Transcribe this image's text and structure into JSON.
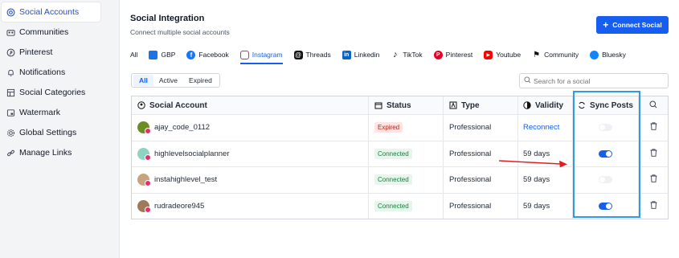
{
  "sidebar": {
    "items": [
      {
        "label": "Social Accounts",
        "icon": "at-icon"
      },
      {
        "label": "Communities",
        "icon": "people-icon"
      },
      {
        "label": "Pinterest",
        "icon": "pinterest-icon"
      },
      {
        "label": "Notifications",
        "icon": "bell-icon"
      },
      {
        "label": "Social Categories",
        "icon": "category-icon"
      },
      {
        "label": "Watermark",
        "icon": "watermark-icon"
      },
      {
        "label": "Global Settings",
        "icon": "gear-icon"
      },
      {
        "label": "Manage Links",
        "icon": "link-icon"
      }
    ]
  },
  "header": {
    "title": "Social Integration",
    "subtitle": "Connect multiple social accounts",
    "connect_button": "Connect Social"
  },
  "tabs": [
    "All",
    "GBP",
    "Facebook",
    "Instagram",
    "Threads",
    "Linkedin",
    "TikTok",
    "Pinterest",
    "Youtube",
    "Community",
    "Bluesky"
  ],
  "filters": [
    "All",
    "Active",
    "Expired"
  ],
  "search": {
    "placeholder": "Search for a social"
  },
  "table": {
    "headers": {
      "account": "Social Account",
      "status": "Status",
      "type": "Type",
      "validity": "Validity",
      "sync": "Sync Posts"
    },
    "rows": [
      {
        "name": "ajay_code_0112",
        "status": "Expired",
        "type": "Professional",
        "validity": "Reconnect",
        "sync": false
      },
      {
        "name": "highlevelsocialplanner",
        "status": "Connected",
        "type": "Professional",
        "validity": "59 days",
        "sync": true
      },
      {
        "name": "instahighlevel_test",
        "status": "Connected",
        "type": "Professional",
        "validity": "59 days",
        "sync": false
      },
      {
        "name": "rudradeore945",
        "status": "Connected",
        "type": "Professional",
        "validity": "59 days",
        "sync": true
      }
    ]
  },
  "colors": {
    "accent": "#155eef",
    "highlight": "#2e9bea",
    "arrow": "#e11d24"
  }
}
